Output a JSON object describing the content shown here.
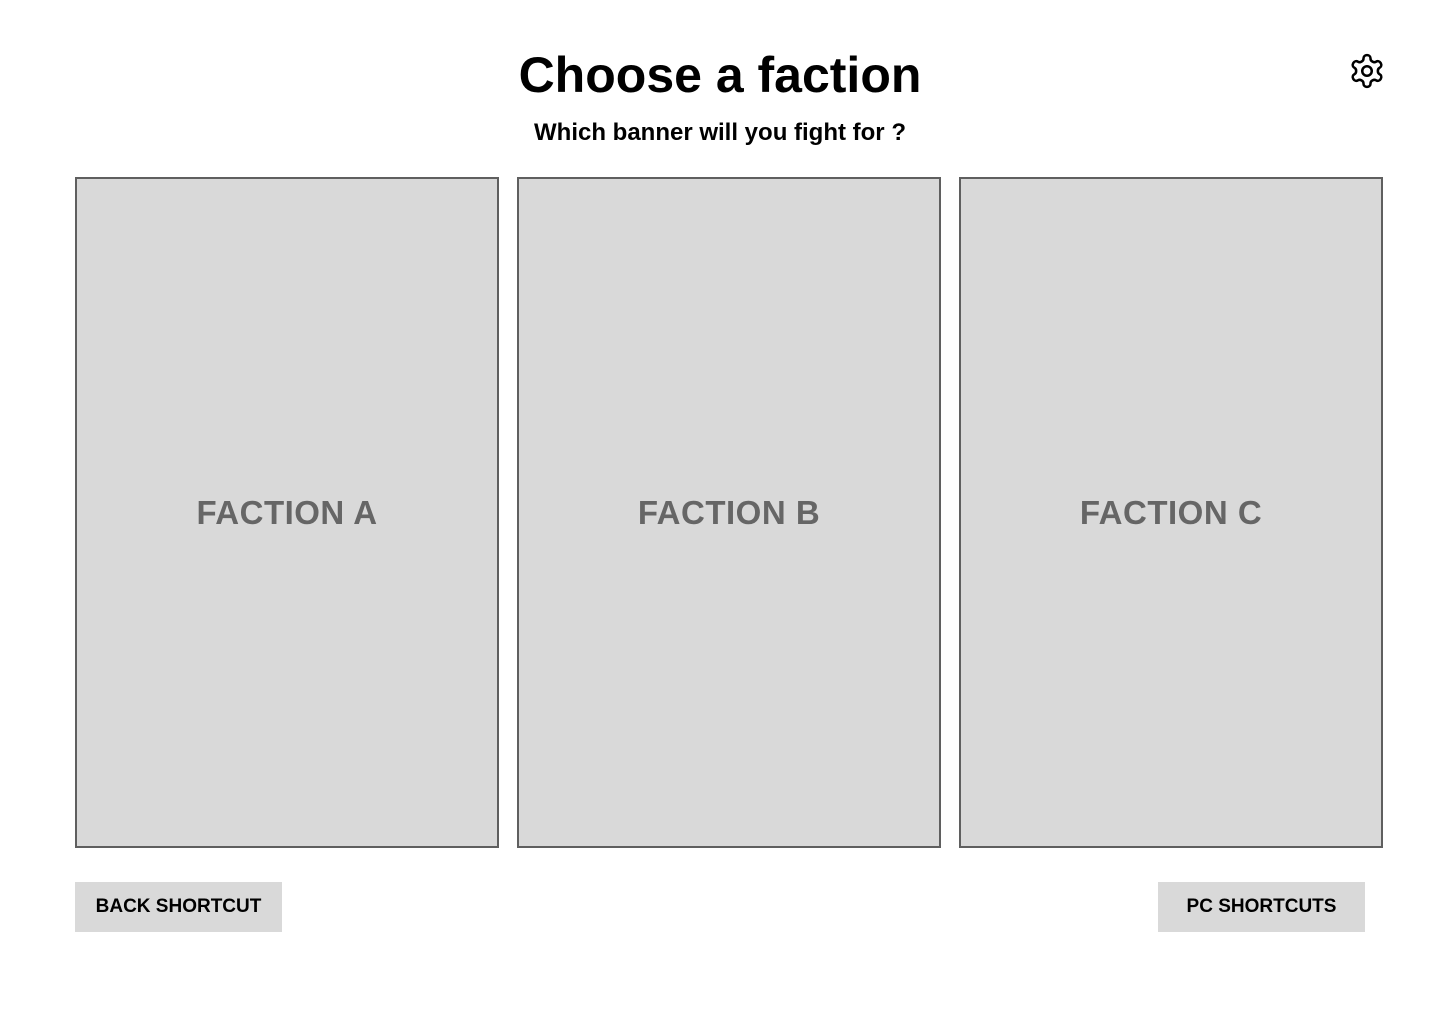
{
  "header": {
    "title": "Choose a faction",
    "subtitle": "Which banner will you fight for ?",
    "settings_icon": "gear-icon"
  },
  "factions": [
    {
      "label": "FACTION A"
    },
    {
      "label": "FACTION B"
    },
    {
      "label": "FACTION C"
    }
  ],
  "footer": {
    "back_label": "BACK SHORTCUT",
    "shortcuts_label": "PC SHORTCUTS"
  },
  "colors": {
    "card_background": "#d9d9d9",
    "card_border": "#5f5f5f",
    "card_label": "#666666",
    "button_background": "#d9d9d9"
  }
}
